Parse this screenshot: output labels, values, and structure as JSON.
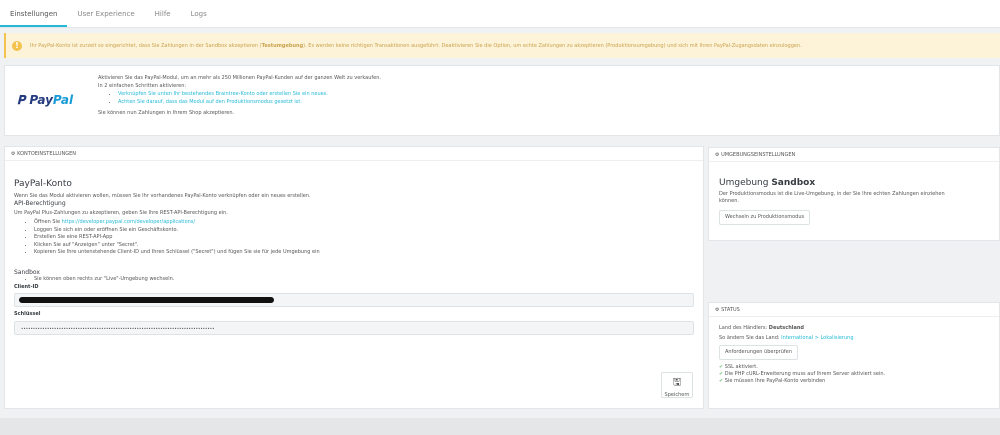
{
  "tabs": [
    "Einstellungen",
    "User Experience",
    "Hilfe",
    "Logs"
  ],
  "alert": {
    "pre": "Ihr PayPal-Konto ist zurzeit so eingerichtet, dass Sie Zahlungen in der Sandbox akzeptieren (",
    "bold": "Testumgebung",
    "post": "). Es werden keine richtigen Transaktionen ausgeführt. Deaktivieren Sie die Option, um echte Zahlungen zu akzeptieren (Produktionsumgebung) und sich mit Ihren PayPal-Zugangsdaten einzuloggen."
  },
  "intro": {
    "logo_a": "Pay",
    "logo_b": "Pal",
    "line1": "Aktivieren Sie das PayPal-Modul, um an mehr als 250 Millionen PayPal-Kunden auf der ganzen Welt zu verkaufen.",
    "line2": "In 2 einfachen Schritten aktivieren:",
    "steps": [
      "Verknüpfen Sie unten Ihr bestehendes Braintree-Konto oder erstellen Sie ein neues.",
      "Achten Sie darauf, dass das Modul auf den Produktionsmodus gesetzt ist."
    ],
    "line3": "Sie können nun Zahlungen in Ihrem Shop akzeptieren."
  },
  "account": {
    "header": "Kontoeinstellungen",
    "title": "PayPal-Konto",
    "desc": "Wenn Sie das Modul aktivieren wollen, müssen Sie Ihr vorhandenes PayPal-Konto verknüpfen oder ein neues erstellen.",
    "api_title": "API-Berechtigung",
    "api_desc": "Um PayPal Plus-Zahlungen zu akzeptieren, geben Sie Ihre REST-API-Berechtigung ein.",
    "open_prefix": "Öffnen Sie ",
    "open_link": "https://developer.paypal.com/developer/applications/",
    "steps": [
      "Loggen Sie sich ein oder eröffnen Sie ein Geschäftskonto.",
      "Erstellen Sie eine REST-API-App",
      "Klicken Sie auf \"Anzeigen\" unter \"Secret\".",
      "Kopieren Sie Ihre untenstehende Client-ID und Ihren Schlüssel (\"Secret\") und fügen Sie sie für jede Umgebung ein"
    ],
    "sandbox_title": "Sandbox",
    "sandbox_note": "Sie können oben rechts zur \"Live\"-Umgebung wechseln.",
    "client_label": "Client-ID",
    "key_label": "Schlüssel",
    "key_value": "••••••••••••••••••••••••••••••••••••••••••••••••••••••••••••••••••••••••••••••••••",
    "save": "Speichern"
  },
  "env": {
    "header": "Umgebungseinstellungen",
    "title_a": "Umgebung ",
    "title_b": "Sandbox",
    "desc": "Der Produktionsmodus ist die Live-Umgebung, in der Sie Ihre echten Zahlungen einziehen können.",
    "button": "Wechseln zu Produktionsmodus"
  },
  "status": {
    "header": "Status",
    "country_label": "Land des Händlers: ",
    "country": "Deutschland",
    "change_label": "So ändern Sie das Land: ",
    "change_link": "International > Lokalisierung",
    "button": "Anforderungen überprüfen",
    "checks": [
      "SSL aktiviert.",
      "Die PHP cURL-Erweiterung muss auf Ihrem Server aktiviert sein.",
      "Sie müssen Ihre PayPal-Konto verbinden"
    ]
  }
}
